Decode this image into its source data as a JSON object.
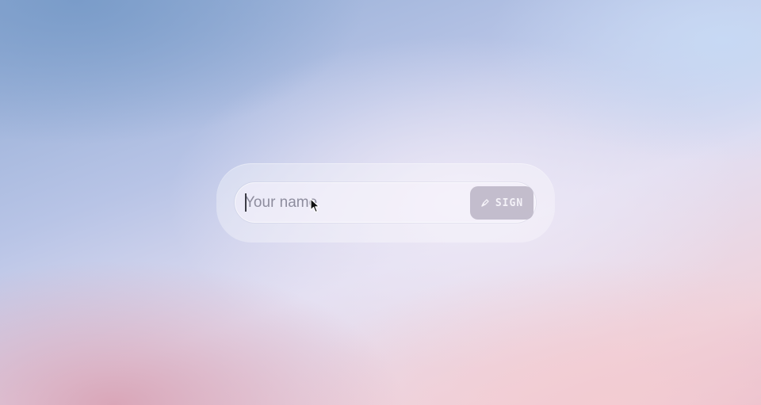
{
  "form": {
    "name_placeholder": "Your name",
    "name_value": "",
    "sign_label": "SIGN",
    "sign_icon": "pen-nib-icon"
  },
  "colors": {
    "button_bg": "#bab4c4",
    "button_text": "#f4f2f8",
    "placeholder": "#8e8d9e"
  }
}
